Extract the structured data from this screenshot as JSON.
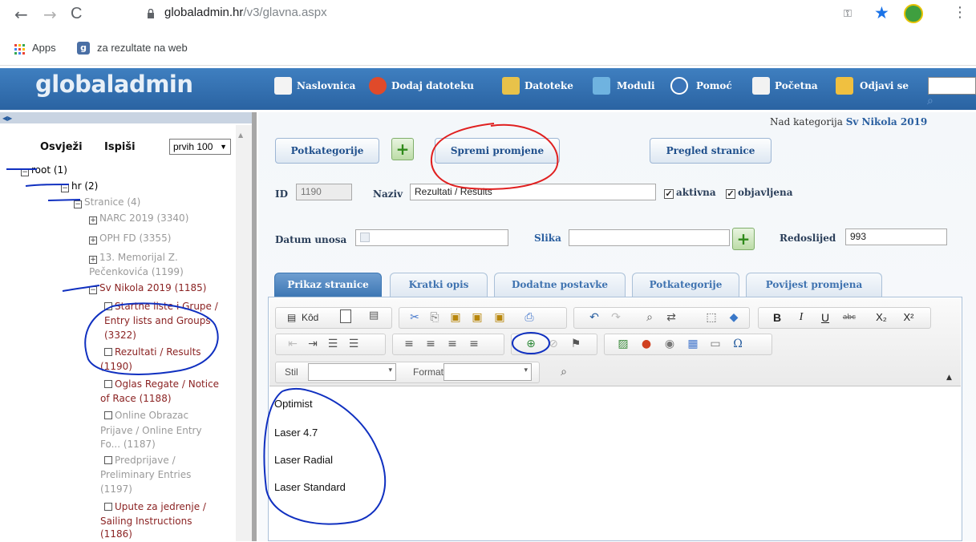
{
  "browser": {
    "back": "←",
    "forward": "→",
    "reload": "C",
    "url_host": "globaladmin.hr",
    "url_path": "/v3/glavna.aspx",
    "bookmarks": [
      {
        "label": "Apps"
      },
      {
        "label": "za rezultate na web"
      }
    ]
  },
  "app": {
    "logo": "globaladmin",
    "nav": [
      "Naslovnica",
      "Dodaj datoteku",
      "Datoteke",
      "Moduli",
      "Pomoć",
      "Početna",
      "Odjavi se"
    ]
  },
  "left": {
    "refresh": "Osvježi",
    "print": "Ispiši",
    "limit_select": "prvih 100",
    "tree": [
      {
        "label": "root (1)"
      },
      {
        "label": "hr (2)"
      },
      {
        "label": "Stranice (4)"
      },
      {
        "label": "NARC 2019 (3340)"
      },
      {
        "label": "OPH FD (3355)"
      },
      {
        "label": "13. Memorijal Z."
      },
      {
        "label": "Pečenkovića (1199)"
      },
      {
        "label": "Sv Nikola 2019 (1185)"
      },
      {
        "label": "Startne liste i Grupe /"
      },
      {
        "label": "Entry lists and Groups"
      },
      {
        "label": "(3322)"
      },
      {
        "label": "Rezultati / Results"
      },
      {
        "label": "(1190)"
      },
      {
        "label": "Oglas Regate / Notice"
      },
      {
        "label": "of Race (1188)"
      },
      {
        "label": "Online Obrazac"
      },
      {
        "label": "Prijave / Online Entry"
      },
      {
        "label": "Fo... (1187)"
      },
      {
        "label": "Predprijave /"
      },
      {
        "label": "Preliminary Entries"
      },
      {
        "label": "(1197)"
      },
      {
        "label": "Upute za jedrenje /"
      },
      {
        "label": "Sailing Instructions"
      },
      {
        "label": "(1186)"
      }
    ]
  },
  "main": {
    "parent_label": "Nad kategorija",
    "parent_value": "Sv Nikola 2019",
    "btn_subcat": "Potkategorije",
    "btn_save": "Spremi promjene",
    "btn_preview": "Pregled stranice",
    "plus": "+",
    "id_label": "ID",
    "id_value": "1190",
    "name_label": "Naziv",
    "name_value": "Rezultati / Results",
    "active_label": "aktivna",
    "published_label": "objavljena",
    "date_label": "Datum unosa",
    "image_label": "Slika",
    "order_label": "Redoslijed",
    "order_value": "993",
    "tabs": [
      "Prikaz stranice",
      "Kratki opis",
      "Dodatne postavke",
      "Potkategorije",
      "Povijest promjena"
    ],
    "editor": {
      "source": "Kôd",
      "style_label": "Stil",
      "format_label": "Format",
      "lines": [
        "Optimist",
        "Laser 4.7",
        "Laser Radial",
        "Laser Standard"
      ]
    }
  },
  "colors": {
    "header_blue": "#2f6aa8",
    "button_text": "#1f4f8c",
    "tree_red": "#8b2323",
    "annotation_red": "#e02020",
    "annotation_blue": "#1030c0"
  }
}
